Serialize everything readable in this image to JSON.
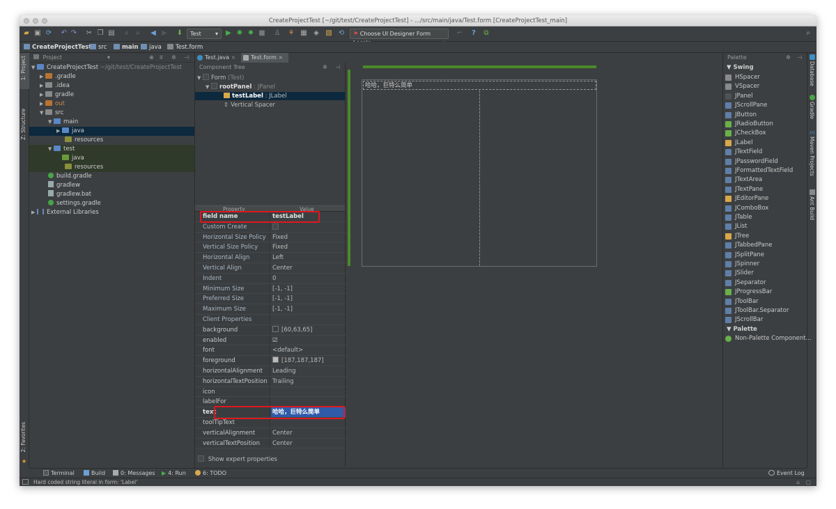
{
  "window": {
    "title": "CreateProjectTest [~/git/test/CreateProjectTest] - .../src/main/java/Test.form [CreateProjectTest_main]"
  },
  "toolbar": {
    "run_config": "Test",
    "locale_combo": "Choose UI Designer Form Locale"
  },
  "breadcrumb": [
    "CreateProjectTest",
    "src",
    "main",
    "java",
    "Test.form"
  ],
  "left_strip": {
    "project": "1: Project",
    "structure": "Z: Structure",
    "favorites": "2: Favorites"
  },
  "right_strip": {
    "database": "Database",
    "gradle": "Gradle",
    "maven": "Maven Projects",
    "ant": "Ant Build"
  },
  "project_panel": {
    "header": "Project",
    "items": [
      {
        "label": "CreateProjectTest",
        "path": "~/git/test/CreateProjectTest"
      },
      {
        "label": ".gradle"
      },
      {
        "label": ".idea"
      },
      {
        "label": "gradle"
      },
      {
        "label": "out"
      },
      {
        "label": "src"
      },
      {
        "label": "main"
      },
      {
        "label": "java"
      },
      {
        "label": "resources"
      },
      {
        "label": "test"
      },
      {
        "label": "java"
      },
      {
        "label": "resources"
      },
      {
        "label": "build.gradle"
      },
      {
        "label": "gradlew"
      },
      {
        "label": "gradlew.bat"
      },
      {
        "label": "settings.gradle"
      },
      {
        "label": "External Libraries"
      }
    ]
  },
  "editor_tabs": [
    "Test.java",
    "Test.form"
  ],
  "component_tree": {
    "header": "Component Tree",
    "form_label": "Form",
    "form_type": "(Test)",
    "root_label": "rootPanel",
    "root_type": "JPanel",
    "label_name": "testLabel",
    "label_type": "JLabel",
    "spacer": "Vertical Spacer"
  },
  "properties": {
    "col_property": "Property",
    "col_value": "Value",
    "rows": [
      {
        "name": "field name",
        "value": "testLabel"
      },
      {
        "name": "Custom Create",
        "value": ""
      },
      {
        "name": "Horizontal Size Policy",
        "value": "Fixed"
      },
      {
        "name": "Vertical Size Policy",
        "value": "Fixed"
      },
      {
        "name": "Horizontal Align",
        "value": "Left"
      },
      {
        "name": "Vertical Align",
        "value": "Center"
      },
      {
        "name": "Indent",
        "value": "0"
      },
      {
        "name": "Minimum Size",
        "value": "[-1, -1]"
      },
      {
        "name": "Preferred Size",
        "value": "[-1, -1]"
      },
      {
        "name": "Maximum Size",
        "value": "[-1, -1]"
      },
      {
        "name": "Client Properties",
        "value": ""
      },
      {
        "name": "background",
        "value": "[60,63,65]"
      },
      {
        "name": "enabled",
        "value": ""
      },
      {
        "name": "font",
        "value": "<default>"
      },
      {
        "name": "foreground",
        "value": "[187,187,187]"
      },
      {
        "name": "horizontalAlignment",
        "value": "Leading"
      },
      {
        "name": "horizontalTextPosition",
        "value": "Trailing"
      },
      {
        "name": "icon",
        "value": ""
      },
      {
        "name": "labelFor",
        "value": ""
      },
      {
        "name": "text",
        "value": "哈哈，巨特么简单"
      },
      {
        "name": "toolTipText",
        "value": ""
      },
      {
        "name": "verticalAlignment",
        "value": "Center"
      },
      {
        "name": "verticalTextPosition",
        "value": "Center"
      }
    ],
    "expert": "Show expert properties",
    "colors": {
      "background": "#3c3f41",
      "foreground": "#bbbbbb"
    }
  },
  "designer": {
    "label_text": "哈哈，巨特么简单"
  },
  "palette": {
    "header": "Palette",
    "swing_group": "Swing",
    "items": [
      "HSpacer",
      "VSpacer",
      "JPanel",
      "JScrollPane",
      "JButton",
      "JRadioButton",
      "JCheckBox",
      "JLabel",
      "JTextField",
      "JPasswordField",
      "JFormattedTextField",
      "JTextArea",
      "JTextPane",
      "JEditorPane",
      "JComboBox",
      "JTable",
      "JList",
      "JTree",
      "JTabbedPane",
      "JSplitPane",
      "JSpinner",
      "JSlider",
      "JSeparator",
      "JProgressBar",
      "JToolBar",
      "JToolBar.Separator",
      "JScrollBar"
    ],
    "palette_group": "Palette",
    "non_palette": "Non-Palette Component..."
  },
  "bottom_tools": {
    "terminal": "Terminal",
    "build": "Build",
    "messages": "0: Messages",
    "run": "4: Run",
    "todo": "6: TODO",
    "event_log": "Event Log"
  },
  "status": {
    "message": "Hard coded string literal in form: 'Label'"
  },
  "accent": {
    "selection": "#0d293e",
    "highlight_box": "#e0171f",
    "value_edit": "#2f5ba8",
    "green": "#4a8a2a"
  }
}
